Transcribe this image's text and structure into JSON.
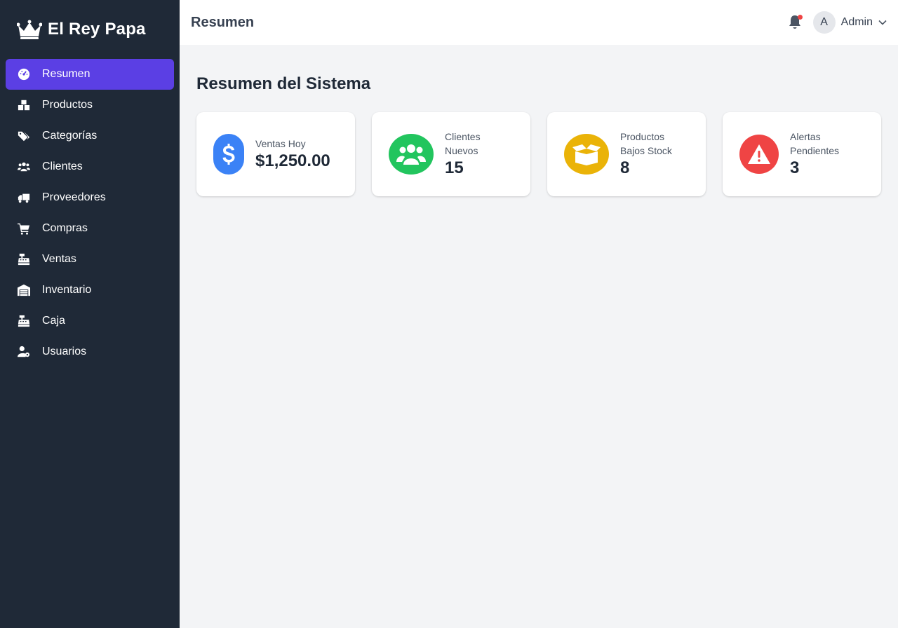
{
  "brand": {
    "name": "El Rey Papa",
    "icon": "crown-icon"
  },
  "sidebar": {
    "items": [
      {
        "label": "Resumen",
        "icon": "dashboard-icon",
        "active": true
      },
      {
        "label": "Productos",
        "icon": "boxes-icon"
      },
      {
        "label": "Categorías",
        "icon": "tags-icon"
      },
      {
        "label": "Clientes",
        "icon": "users-icon"
      },
      {
        "label": "Proveedores",
        "icon": "truck-icon"
      },
      {
        "label": "Compras",
        "icon": "cart-icon"
      },
      {
        "label": "Ventas",
        "icon": "cash-register-icon"
      },
      {
        "label": "Inventario",
        "icon": "warehouse-icon"
      },
      {
        "label": "Caja",
        "icon": "cash-register-icon"
      },
      {
        "label": "Usuarios",
        "icon": "user-gear-icon"
      }
    ]
  },
  "header": {
    "title": "Resumen",
    "user": {
      "initial": "A",
      "name": "Admin"
    }
  },
  "main": {
    "title": "Resumen del Sistema",
    "cards": [
      {
        "label": "Ventas Hoy",
        "value": "$1,250.00",
        "icon": "dollar-icon",
        "color": "#3b82f6"
      },
      {
        "label": "Clientes Nuevos",
        "value": "15",
        "icon": "users-icon",
        "color": "#22c55e"
      },
      {
        "label": "Productos Bajos Stock",
        "value": "8",
        "icon": "box-open-icon",
        "color": "#eab308"
      },
      {
        "label": "Alertas Pendientes",
        "value": "3",
        "icon": "warning-icon",
        "color": "#ef4444"
      }
    ]
  },
  "colors": {
    "sidebar_bg": "#1f2937",
    "active": "#5b3fe4",
    "background": "#f3f4f6"
  }
}
